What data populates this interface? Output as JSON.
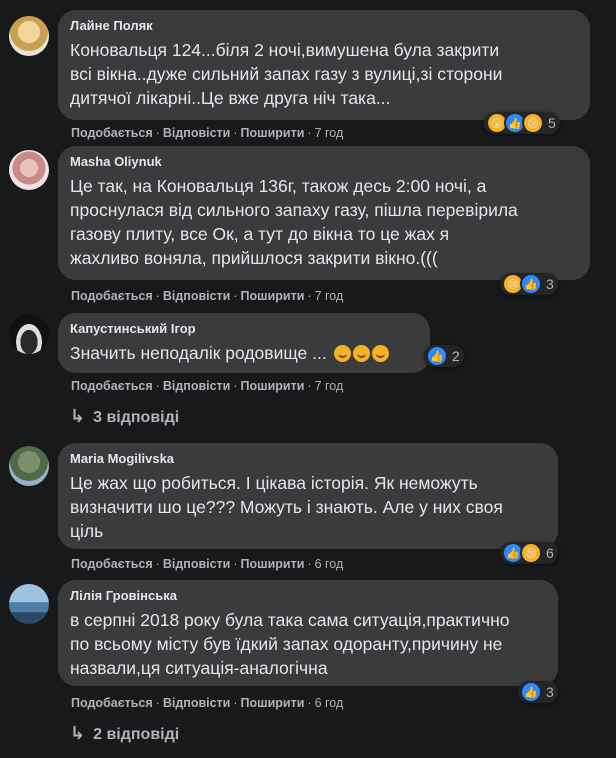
{
  "comments": [
    {
      "author": "Лайне Поляк",
      "text": "Коновальця 124...біля 2 ночі,вимушена була закрити\nвсі вікна..дуже сильний запах газу з вулиці,зі сторони\nдитячої лікарні..Це вже друга ніч така...",
      "like": "Подобається",
      "reply": "Відповісти",
      "share": "Поширити",
      "time": "7 год",
      "reactions": [
        "wow-icon",
        "like-icon",
        "sad-icon"
      ],
      "count": "5"
    },
    {
      "author": "Masha Oliynuk",
      "text": "Це так, на Коновальця 136г, також десь 2:00 ночі, а\nпроснулася від сильного запаху газу, пішла перевірила\nгазову плиту, все Ок, а тут до вікна то це жах я\nжахливо воняла, прийшлося закрити вікно.(((",
      "like": "Подобається",
      "reply": "Відповісти",
      "share": "Поширити",
      "time": "7 год",
      "reactions": [
        "sad-icon",
        "like-icon"
      ],
      "count": "3"
    },
    {
      "author": "Капустинський Ігор",
      "text": "Значить неподалік родовище ...",
      "like": "Подобається",
      "reply": "Відповісти",
      "share": "Поширити",
      "time": "7 год",
      "reactions": [
        "like-icon"
      ],
      "count": "2"
    },
    {
      "author": "Maria Mogilivska",
      "text": "Це жах що робиться. І цікава історія. Як неможуть\nвизначити шо це??? Можуть і знають. Але у них своя\nціль",
      "like": "Подобається",
      "reply": "Відповісти",
      "share": "Поширити",
      "time": "6 год",
      "reactions": [
        "like-icon",
        "sad-icon"
      ],
      "count": "6"
    },
    {
      "author": "Лілія Гровінська",
      "text": "в серпні 2018 року була така сама ситуація,практично\nпо всьому місту був їдкий запах одоранту,причину не\nназвали,ця ситуація-аналогічна",
      "like": "Подобається",
      "reply": "Відповісти",
      "share": "Поширити",
      "time": "6 год",
      "reactions": [
        "like-icon"
      ],
      "count": "3"
    }
  ],
  "replies": [
    {
      "label": "3 відповіді"
    },
    {
      "label": "2 відповіді"
    }
  ],
  "colors": {
    "background": "#18191a",
    "bubble": "#3a3b3c",
    "text": "#e4e6eb",
    "secondary": "#b0b3b8",
    "like": "#2e89ff",
    "emoji": "#f7b125"
  }
}
